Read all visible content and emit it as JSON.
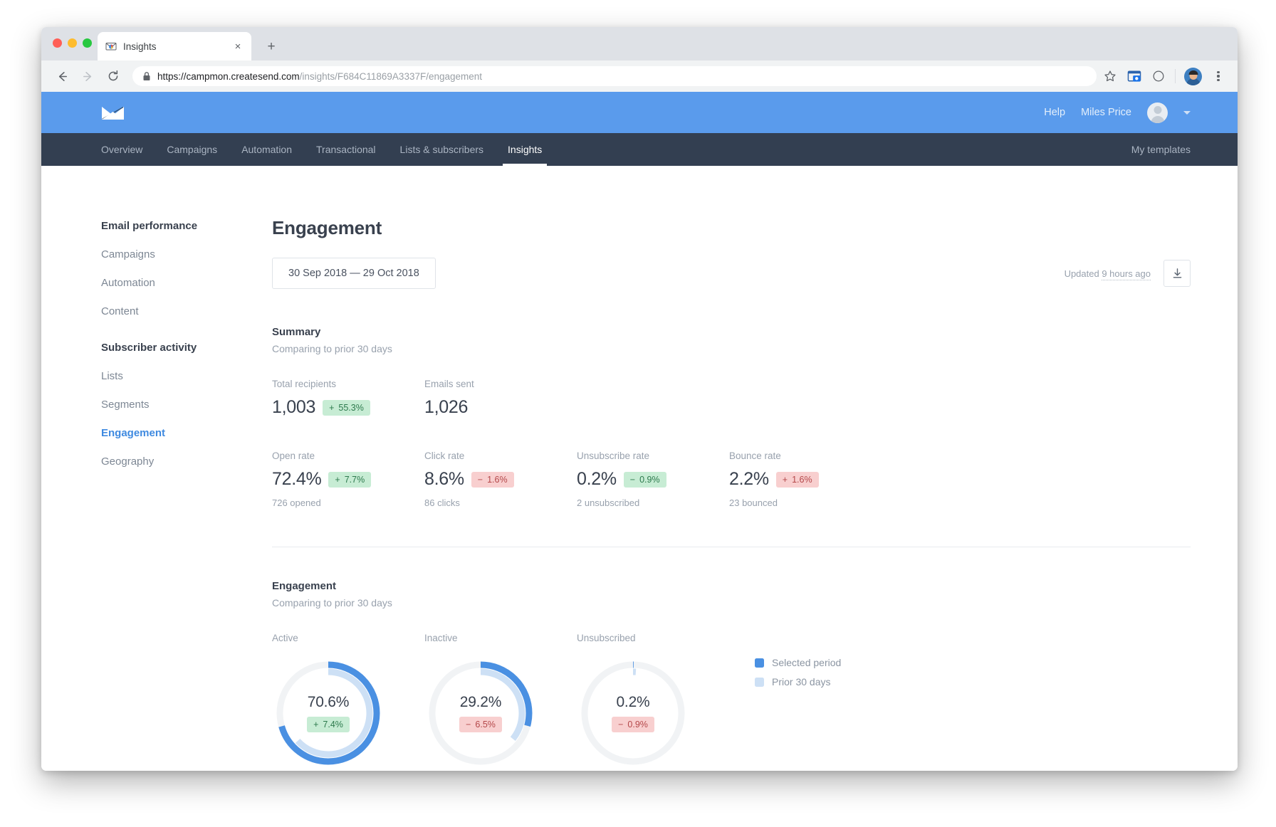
{
  "browser": {
    "tab": {
      "title": "Insights",
      "favicon": "mail-chart-icon",
      "close": "×"
    },
    "new_tab": "+",
    "back": "←",
    "forward": "→",
    "reload": "↻",
    "url_secure_prefix": "https://campmon.createsend.com",
    "url_path": "/insights/F684C11869A3337F/engagement",
    "toolbar_icons": [
      "bookmark-star-icon",
      "screen-capture-icon",
      "circle-icon",
      "profile-avatar",
      "kebab-menu-icon"
    ]
  },
  "app": {
    "logo": "campaign-monitor-envelope-logo",
    "header": {
      "help_label": "Help",
      "user_name": "Miles Price"
    },
    "nav": {
      "items": [
        {
          "label": "Overview",
          "active": false
        },
        {
          "label": "Campaigns",
          "active": false
        },
        {
          "label": "Automation",
          "active": false
        },
        {
          "label": "Transactional",
          "active": false
        },
        {
          "label": "Lists & subscribers",
          "active": false
        },
        {
          "label": "Insights",
          "active": true
        }
      ],
      "right_label": "My templates"
    },
    "sidebar": {
      "group1_title": "Email performance",
      "group1_items": [
        {
          "label": "Campaigns",
          "active": false
        },
        {
          "label": "Automation",
          "active": false
        },
        {
          "label": "Content",
          "active": false
        }
      ],
      "group2_title": "Subscriber activity",
      "group2_items": [
        {
          "label": "Lists",
          "active": false
        },
        {
          "label": "Segments",
          "active": false
        },
        {
          "label": "Engagement",
          "active": true
        },
        {
          "label": "Geography",
          "active": false
        }
      ]
    },
    "page_title": "Engagement",
    "date_range": "30 Sep 2018 — 29 Oct 2018",
    "updated_prefix": "Updated ",
    "updated_value": "9 hours ago",
    "download_icon": "download-icon",
    "summary": {
      "title": "Summary",
      "subtitle": "Comparing to prior 30 days",
      "top_metrics": [
        {
          "label": "Total recipients",
          "value": "1,003",
          "delta_sign": "+",
          "delta": "55.3%",
          "delta_dir": "up",
          "sub": ""
        },
        {
          "label": "Emails sent",
          "value": "1,026",
          "delta_sign": "",
          "delta": "",
          "delta_dir": "",
          "sub": ""
        }
      ],
      "rate_metrics": [
        {
          "label": "Open rate",
          "value": "72.4%",
          "delta_sign": "+",
          "delta": "7.7%",
          "delta_dir": "up",
          "sub": "726 opened"
        },
        {
          "label": "Click rate",
          "value": "8.6%",
          "delta_sign": "−",
          "delta": "1.6%",
          "delta_dir": "down",
          "sub": "86 clicks"
        },
        {
          "label": "Unsubscribe rate",
          "value": "0.2%",
          "delta_sign": "−",
          "delta": "0.9%",
          "delta_dir": "up",
          "sub": "2 unsubscribed"
        },
        {
          "label": "Bounce rate",
          "value": "2.2%",
          "delta_sign": "+",
          "delta": "1.6%",
          "delta_dir": "down",
          "sub": "23 bounced"
        }
      ]
    },
    "engagement": {
      "title": "Engagement",
      "subtitle": "Comparing to prior 30 days",
      "legend": [
        {
          "label": "Selected period",
          "color": "#4a90e2"
        },
        {
          "label": "Prior 30 days",
          "color": "#cde0f5"
        }
      ]
    }
  },
  "chart_data": {
    "type": "pie",
    "title": "Engagement",
    "subtitle": "Comparing to prior 30 days",
    "legend_position": "right",
    "series": [
      {
        "name": "Selected period",
        "color": "#4a90e2"
      },
      {
        "name": "Prior 30 days",
        "color": "#cde0f5"
      }
    ],
    "categories": [
      "Active",
      "Inactive",
      "Unsubscribed"
    ],
    "donuts": [
      {
        "label": "Active",
        "value_pct": 70.6,
        "value_text": "70.6%",
        "prior_pct": 63.2,
        "delta_sign": "+",
        "delta": "7.4%",
        "delta_dir": "up"
      },
      {
        "label": "Inactive",
        "value_pct": 29.2,
        "value_text": "29.2%",
        "prior_pct": 35.7,
        "delta_sign": "−",
        "delta": "6.5%",
        "delta_dir": "down"
      },
      {
        "label": "Unsubscribed",
        "value_pct": 0.2,
        "value_text": "0.2%",
        "prior_pct": 1.1,
        "delta_sign": "−",
        "delta": "0.9%",
        "delta_dir": "down"
      }
    ]
  }
}
